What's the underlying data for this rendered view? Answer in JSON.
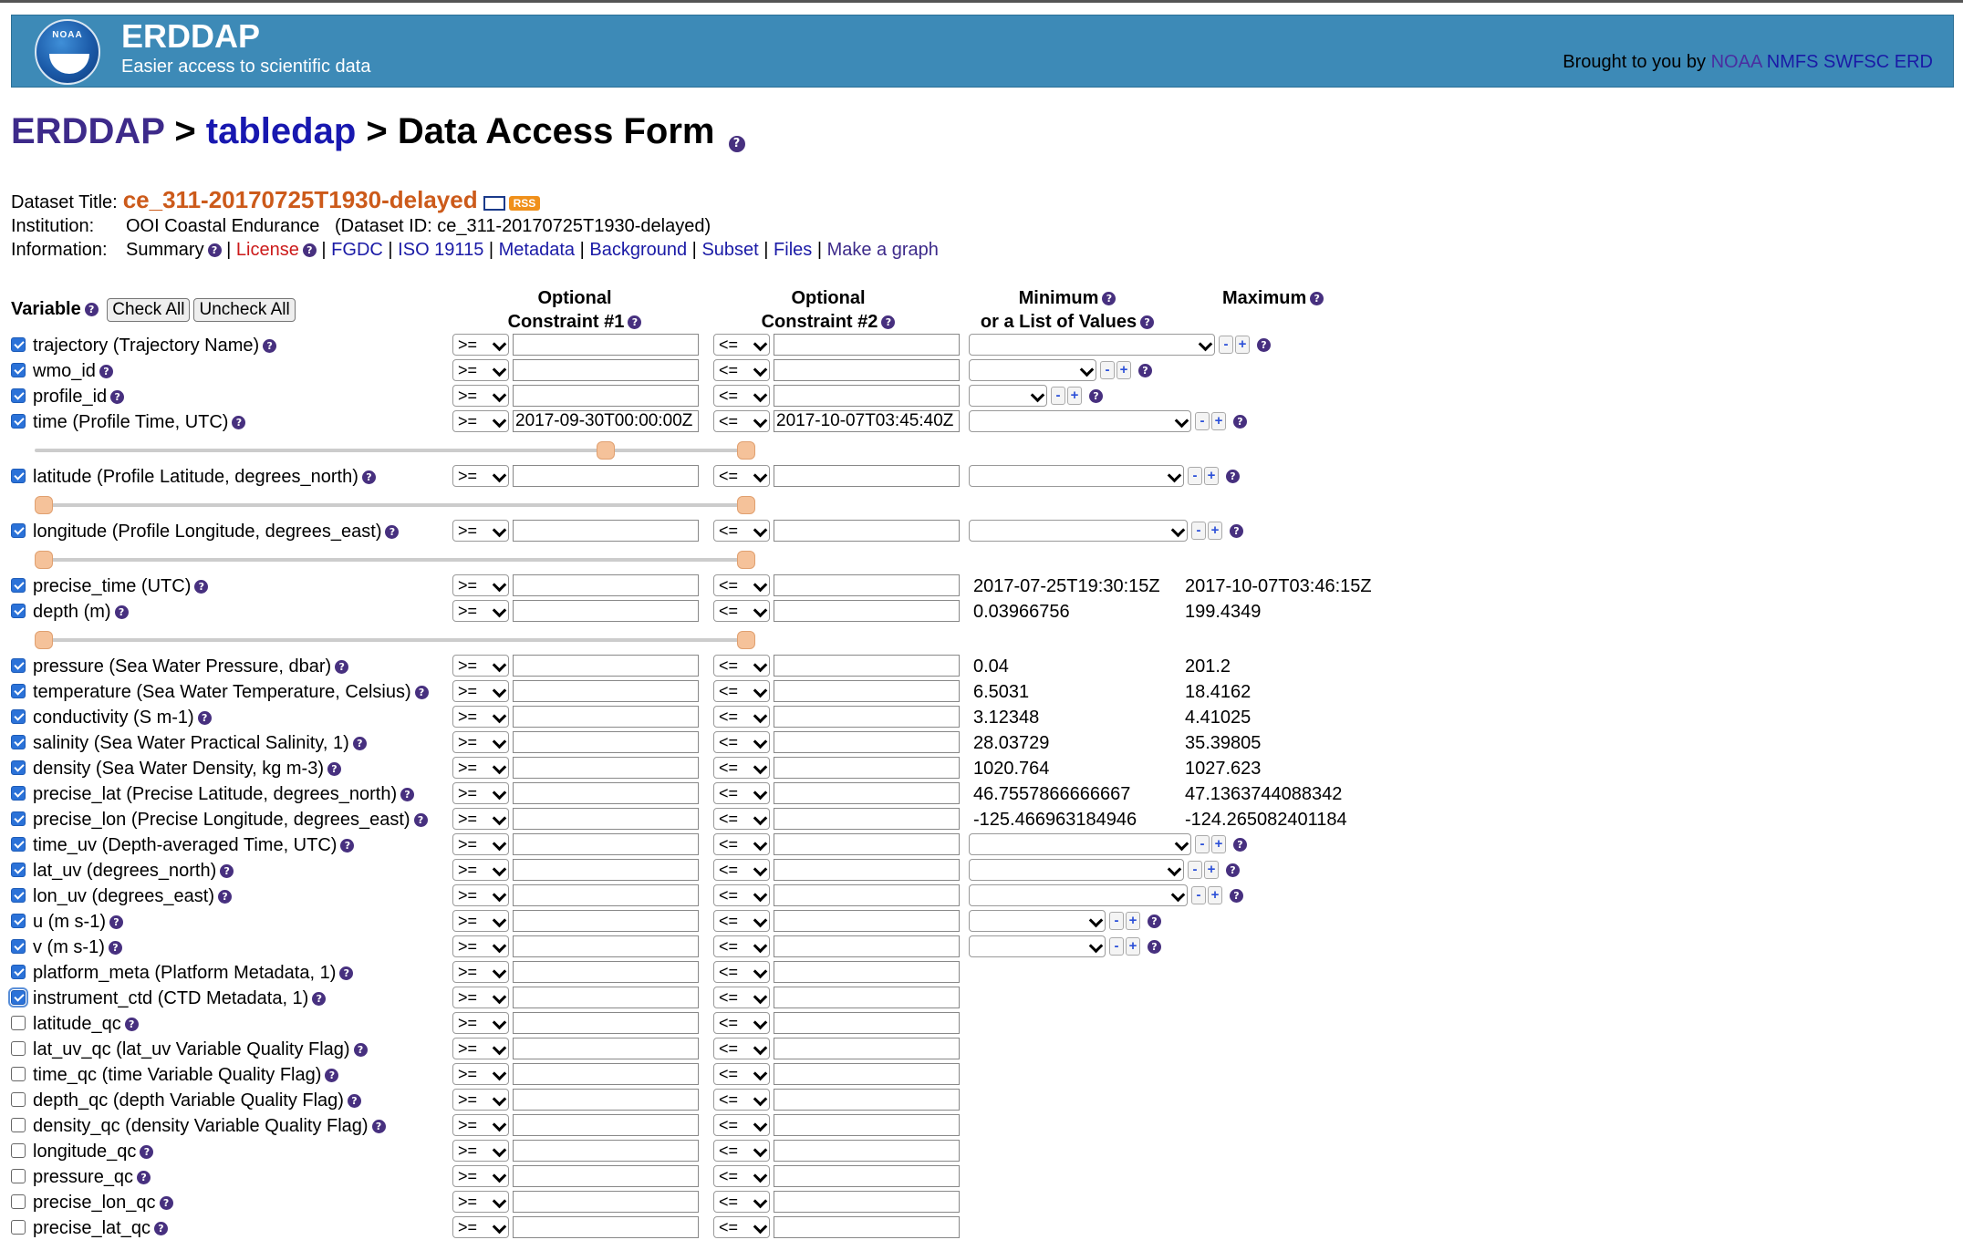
{
  "header": {
    "logo_text": "NOAA",
    "brand_title": "ERDDAP",
    "brand_subtitle": "Easier access to scientific data",
    "brought_prefix": "Brought to you by",
    "brought_links": [
      "NOAA",
      "NMFS",
      "SWFSC",
      "ERD"
    ]
  },
  "breadcrumb": {
    "home": "ERDDAP",
    "sep1": ">",
    "section": "tabledap",
    "sep2": ">",
    "page": "Data Access Form"
  },
  "dataset": {
    "title_label": "Dataset Title:",
    "title": "ce_311-20170725T1930-delayed",
    "rss_label": "RSS",
    "institution_label": "Institution:",
    "institution": "OOI Coastal Endurance",
    "dataset_id_text": "(Dataset ID: ce_311-20170725T1930-delayed)",
    "information_label": "Information:",
    "info_links": {
      "summary": "Summary",
      "license": "License",
      "fgdc": "FGDC",
      "iso": "ISO 19115",
      "metadata": "Metadata",
      "background": "Background",
      "subset": "Subset",
      "files": "Files",
      "make_graph": "Make a graph"
    },
    "sep": "|"
  },
  "table_headers": {
    "variable": "Variable",
    "check_all": "Check All",
    "uncheck_all": "Uncheck All",
    "c1_line1": "Optional",
    "c1_line2": "Constraint #1",
    "c2_line1": "Optional",
    "c2_line2": "Constraint #2",
    "min_line1": "Minimum",
    "min_line2": "or a List of Values",
    "max": "Maximum"
  },
  "operators": {
    "op1": ">=",
    "op2": "<="
  },
  "rows": [
    {
      "name": "trajectory (Trajectory Name)",
      "checked": true,
      "c1": "",
      "c2": "",
      "kind": "list",
      "listw": 270,
      "min": "",
      "max": ""
    },
    {
      "name": "wmo_id",
      "checked": true,
      "c1": "",
      "c2": "",
      "kind": "list",
      "listw": 140,
      "min": "",
      "max": ""
    },
    {
      "name": "profile_id",
      "checked": true,
      "c1": "",
      "c2": "",
      "kind": "list",
      "listw": 86,
      "min": "",
      "max": ""
    },
    {
      "name": "time (Profile Time, UTC)",
      "checked": true,
      "c1": "2017-09-30T00:00:00Z",
      "c2": "2017-10-07T03:45:40Z",
      "kind": "list",
      "listw": 244,
      "min": "",
      "max": "",
      "slider": {
        "start": 0.8,
        "end": 1.0
      }
    },
    {
      "name": "latitude (Profile Latitude, degrees_north)",
      "checked": true,
      "c1": "",
      "c2": "",
      "kind": "list",
      "listw": 236,
      "min": "",
      "max": "",
      "slider": {
        "start": 0.0,
        "end": 1.0
      }
    },
    {
      "name": "longitude (Profile Longitude, degrees_east)",
      "checked": true,
      "c1": "",
      "c2": "",
      "kind": "list",
      "listw": 240,
      "min": "",
      "max": "",
      "slider": {
        "start": 0.0,
        "end": 1.0
      }
    },
    {
      "name": "precise_time (UTC)",
      "checked": true,
      "c1": "",
      "c2": "",
      "kind": "range",
      "min": "2017-07-25T19:30:15Z",
      "max": "2017-10-07T03:46:15Z"
    },
    {
      "name": "depth (m)",
      "checked": true,
      "c1": "",
      "c2": "",
      "kind": "range",
      "min": "0.03966756",
      "max": "199.4349",
      "slider": {
        "start": 0.0,
        "end": 1.0
      }
    },
    {
      "name": "pressure (Sea Water Pressure, dbar)",
      "checked": true,
      "c1": "",
      "c2": "",
      "kind": "range",
      "min": "0.04",
      "max": "201.2"
    },
    {
      "name": "temperature (Sea Water Temperature, Celsius)",
      "checked": true,
      "c1": "",
      "c2": "",
      "kind": "range",
      "min": "6.5031",
      "max": "18.4162"
    },
    {
      "name": "conductivity (S m-1)",
      "checked": true,
      "c1": "",
      "c2": "",
      "kind": "range",
      "min": "3.12348",
      "max": "4.41025"
    },
    {
      "name": "salinity (Sea Water Practical Salinity, 1)",
      "checked": true,
      "c1": "",
      "c2": "",
      "kind": "range",
      "min": "28.03729",
      "max": "35.39805"
    },
    {
      "name": "density (Sea Water Density, kg m-3)",
      "checked": true,
      "c1": "",
      "c2": "",
      "kind": "range",
      "min": "1020.764",
      "max": "1027.623"
    },
    {
      "name": "precise_lat (Precise Latitude, degrees_north)",
      "checked": true,
      "c1": "",
      "c2": "",
      "kind": "range",
      "min": "46.7557866666667",
      "max": "47.1363744088342"
    },
    {
      "name": "precise_lon (Precise Longitude, degrees_east)",
      "checked": true,
      "c1": "",
      "c2": "",
      "kind": "range",
      "min": "-125.466963184946",
      "max": "-124.265082401184"
    },
    {
      "name": "time_uv (Depth-averaged Time, UTC)",
      "checked": true,
      "c1": "",
      "c2": "",
      "kind": "list",
      "listw": 244,
      "min": "",
      "max": ""
    },
    {
      "name": "lat_uv (degrees_north)",
      "checked": true,
      "c1": "",
      "c2": "",
      "kind": "list",
      "listw": 236,
      "min": "",
      "max": ""
    },
    {
      "name": "lon_uv (degrees_east)",
      "checked": true,
      "c1": "",
      "c2": "",
      "kind": "list",
      "listw": 240,
      "min": "",
      "max": ""
    },
    {
      "name": "u (m s-1)",
      "checked": true,
      "c1": "",
      "c2": "",
      "kind": "list",
      "listw": 150,
      "min": "",
      "max": ""
    },
    {
      "name": "v (m s-1)",
      "checked": true,
      "c1": "",
      "c2": "",
      "kind": "list",
      "listw": 150,
      "min": "",
      "max": ""
    },
    {
      "name": "platform_meta (Platform Metadata, 1)",
      "checked": true,
      "c1": "",
      "c2": "",
      "kind": "none",
      "min": "",
      "max": ""
    },
    {
      "name": "instrument_ctd (CTD Metadata, 1)",
      "checked": true,
      "focus": true,
      "c1": "",
      "c2": "",
      "kind": "none",
      "min": "",
      "max": ""
    },
    {
      "name": "latitude_qc",
      "checked": false,
      "c1": "",
      "c2": "",
      "kind": "none",
      "min": "",
      "max": ""
    },
    {
      "name": "lat_uv_qc (lat_uv Variable Quality Flag)",
      "checked": false,
      "c1": "",
      "c2": "",
      "kind": "none",
      "min": "",
      "max": ""
    },
    {
      "name": "time_qc (time Variable Quality Flag)",
      "checked": false,
      "c1": "",
      "c2": "",
      "kind": "none",
      "min": "",
      "max": ""
    },
    {
      "name": "depth_qc (depth Variable Quality Flag)",
      "checked": false,
      "c1": "",
      "c2": "",
      "kind": "none",
      "min": "",
      "max": ""
    },
    {
      "name": "density_qc (density Variable Quality Flag)",
      "checked": false,
      "c1": "",
      "c2": "",
      "kind": "none",
      "min": "",
      "max": ""
    },
    {
      "name": "longitude_qc",
      "checked": false,
      "c1": "",
      "c2": "",
      "kind": "none",
      "min": "",
      "max": ""
    },
    {
      "name": "pressure_qc",
      "checked": false,
      "c1": "",
      "c2": "",
      "kind": "none",
      "min": "",
      "max": ""
    },
    {
      "name": "precise_lon_qc",
      "checked": false,
      "c1": "",
      "c2": "",
      "kind": "none",
      "min": "",
      "max": ""
    },
    {
      "name": "precise_lat_qc",
      "checked": false,
      "c1": "",
      "c2": "",
      "kind": "none",
      "min": "",
      "max": ""
    }
  ],
  "plus_label": "+",
  "minus_label": "-",
  "help_glyph": "?"
}
